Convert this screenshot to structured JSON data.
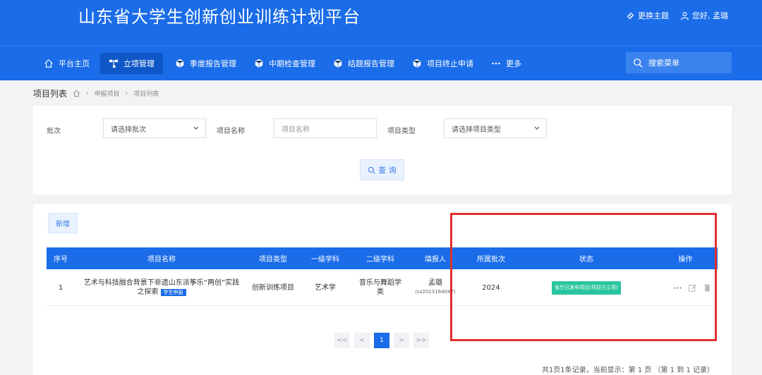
{
  "header": {
    "title": "山东省大学生创新创业训练计划平台",
    "change_theme": "更换主题",
    "greeting": "您好, 孟璐"
  },
  "nav": {
    "items": [
      {
        "label": "平台主页",
        "icon": "home-icon"
      },
      {
        "label": "立项管理",
        "icon": "hierarchy-icon",
        "active": true
      },
      {
        "label": "季度报告管理",
        "icon": "cube-icon"
      },
      {
        "label": "中期检查管理",
        "icon": "cube-icon"
      },
      {
        "label": "结题报告管理",
        "icon": "cube-icon"
      },
      {
        "label": "项目终止申请",
        "icon": "cube-icon"
      },
      {
        "label": "更多",
        "icon": "more-icon"
      }
    ],
    "search_placeholder": "搜索菜单"
  },
  "breadcrumb": {
    "title": "项目列表",
    "items": [
      "申报项目",
      "项目列表"
    ]
  },
  "filters": {
    "batch_label": "批次",
    "batch_placeholder": "请选择批次",
    "name_label": "项目名称",
    "name_placeholder": "项目名称",
    "type_label": "项目类型",
    "type_placeholder": "请选择项目类型",
    "query_label": "查 询"
  },
  "table": {
    "add_label": "新增",
    "headers": [
      "序号",
      "项目名称",
      "项目类型",
      "一级学科",
      "二级学科",
      "填报人",
      "所属批次",
      "状态",
      "操作"
    ],
    "rows": [
      {
        "index": "1",
        "name_line1": "艺术与科技融合背景下非遗山东派筝乐“两创”实践",
        "name_line2": "之探索",
        "badge": "学生申报",
        "type": "创新训练项目",
        "discipline1": "艺术学",
        "discipline2_line1": "音乐与舞蹈学",
        "discipline2_line2": "类",
        "reporter_name": "孟璐",
        "reporter_id": "(sz2023164047)",
        "batch": "2024",
        "status": "省厅已发布项目(项目已立项)"
      }
    ]
  },
  "pagination": {
    "first": "<<",
    "prev": "<",
    "current": "1",
    "next": ">",
    "last": ">>"
  },
  "summary": "共1页1条记录，当前显示：第 1 页 （第 1 到 1 记录）",
  "colors": {
    "primary": "#1a6ce8",
    "status_green": "#29c5a0",
    "highlight_red": "#e0302c"
  }
}
